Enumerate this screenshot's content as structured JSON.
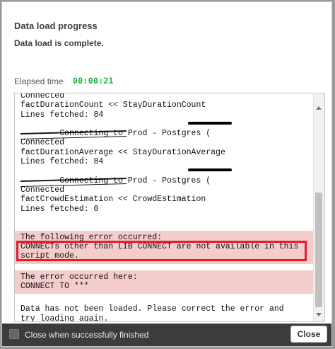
{
  "dialog": {
    "title": "Data load progress",
    "status": "Data load is complete.",
    "elapsed_label": "Elapsed time",
    "elapsed_value": "00:00:21"
  },
  "log": {
    "lines": [
      "Connected",
      "factDurationCount << StayDurationCount",
      "Lines fetched: 84",
      "Connecting to Prod - Postgres (",
      "",
      "Connected",
      "factDurationAverage << StayDurationAverage",
      "Lines fetched: 84",
      "Connecting to Prod - Postgres (",
      "",
      "Connected",
      "factCrowdEstimation << CrowdEstimation",
      "Lines fetched: 0"
    ],
    "error_heading": "The following error occurred:",
    "error_message_1": "CONNECTs other than LIB CONNECT are not available in this",
    "error_message_2": "script mode.",
    "error_location_heading": "The error occurred here:",
    "error_location": "CONNECT TO ***",
    "final_1": "Data has not been loaded. Please correct the error and",
    "final_2": "try loading again."
  },
  "footer": {
    "checkbox_label": "Close when successfully finished",
    "checkbox_checked": false,
    "close_label": "Close"
  },
  "colors": {
    "elapsed": "#17b53f",
    "error_bg": "#f5cccc",
    "highlight": "#e01e2c",
    "footer_bg": "#3c3c3c"
  }
}
